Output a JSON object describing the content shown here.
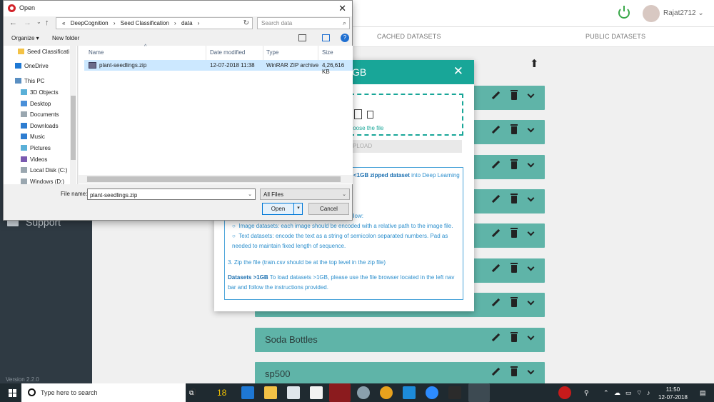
{
  "app": {
    "username": "Rajat2712",
    "tabs": [
      "CACHED DATASETS",
      "PUBLIC DATASETS"
    ],
    "sidebar_support": "Support",
    "version": "Version 2.2.0",
    "datasets": [
      {
        "name": ""
      },
      {
        "name": ""
      },
      {
        "name": ""
      },
      {
        "name": ""
      },
      {
        "name": ""
      },
      {
        "name": ""
      },
      {
        "name": ""
      },
      {
        "name": "Soda Bottles"
      },
      {
        "name": "sp500"
      }
    ]
  },
  "modal": {
    "title": "GB",
    "close": "✕",
    "choose_file": "Choose the file",
    "upload_button": "PLOAD",
    "info": {
      "line1_bold": "<1GB zipped dataset",
      "line1_rest": " into Deep Learning",
      "line2": "llow:",
      "bullet1": "Image datasets: each image should be encoded with a relative path to the image file.",
      "bullet2": "Text datasets: encode the text as a string of semicolon separated numbers. Pad as needed to maintain fixed length of sequence.",
      "step3": "3. Zip the file (train.csv should be at the top level in the zip file)",
      "large_bold": "Datasets >1GB",
      "large_rest": " To load datasets >1GB, please use the file browser located in the left nav bar and follow the instructions provided."
    }
  },
  "dialog": {
    "title": "Open",
    "breadcrumbs": [
      "«",
      "DeepCognition",
      "›",
      "Seed Classification",
      "›",
      "data",
      "›"
    ],
    "search_placeholder": "Search data",
    "organize": "Organize ▾",
    "new_folder": "New folder",
    "nav_items": [
      "Seed Classificati",
      "OneDrive",
      "This PC",
      "3D Objects",
      "Desktop",
      "Documents",
      "Downloads",
      "Music",
      "Pictures",
      "Videos",
      "Local Disk (C:)",
      "Windows (D:)"
    ],
    "columns": [
      "Name",
      "Date modified",
      "Type",
      "Size"
    ],
    "files": [
      {
        "name": "plant-seedlings.zip",
        "date": "12-07-2018 11:38",
        "type": "WinRAR ZIP archive",
        "size": "4,26,616 KB"
      }
    ],
    "file_name_label": "File name:",
    "file_name_value": "plant-seedlings.zip",
    "file_type": "All Files",
    "open_label": "Open",
    "cancel_label": "Cancel"
  },
  "taskbar": {
    "search_placeholder": "Type here to search",
    "time": "11:50",
    "date": "12-07-2018"
  }
}
